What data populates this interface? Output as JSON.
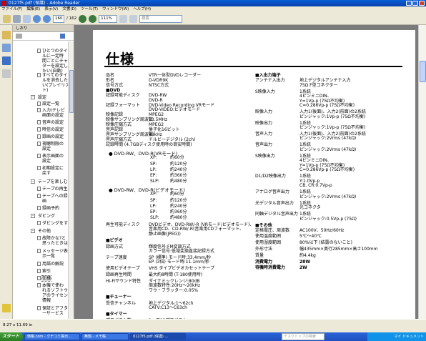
{
  "window": {
    "title": "0127f5.pdf (保護) - Adobe Reader"
  },
  "menu": [
    "ファイル(F)",
    "編集(E)",
    "表示(V)",
    "文書(D)",
    "ツール(T)",
    "ウィンドウ(W)",
    "ヘルプ(H)"
  ],
  "toolbar": {
    "page_current": "160",
    "page_total": "/ 162",
    "zoom": "111%",
    "search_placeholder": "検索"
  },
  "nav": {
    "header": "しおり",
    "items": [
      "ひとつのタイト\nルに一定時\n間ごとにチャプ\nターを設定し\nたい(自動)",
      "すべてのタイト\nルを消去した\nい(プレイリス\nト)",
      "設定",
      "設定一覧",
      "入力/テレビ\n画面の設定",
      "音声の設定",
      "時信の設定",
      "録画の設定",
      "視聴制限の\n設定",
      "表示画面の\n設定",
      "初期設定に\n戻す",
      "テープを楽しむ",
      "テープの再生",
      "テープへの録\n画",
      "録画予約",
      "ダビング",
      "ダビングをする",
      "その他",
      "故障かな?と\n思ったときは",
      "メッセージ表\n示一覧",
      "用語の解説",
      "索引",
      "仕様",
      "本機で使わ\nれるソフトウェ\nアのライセンス\n情報",
      "保証とアフタ\nーサービス"
    ]
  },
  "doc": {
    "title": "仕様",
    "left_rows": [
      {
        "label": "品名",
        "value": "VTR一体型DVDレコーダー"
      },
      {
        "label": "形名",
        "value": "D-VDR9K"
      },
      {
        "label": "信号方式",
        "value": "NTSC方式"
      },
      {
        "label": "■DVD",
        "value": ""
      },
      {
        "label": "記録可能ディスク",
        "value": "DVD-RW\nDVD-R"
      },
      {
        "label": "記録フォーマット",
        "value": "DVD-Video Recording:VRモード\nDVD-VIDEO:ビデオモード"
      },
      {
        "label": "映像記録",
        "value": "MPEG2"
      },
      {
        "label": "映像サンプリング周波数",
        "value": "13.5MHz"
      },
      {
        "label": "映像圧縮方式",
        "value": "MPEG2"
      },
      {
        "label": "音声記録",
        "value": "量子化16ビット"
      },
      {
        "label": "音声サンプリング周波数",
        "value": "48kHz"
      },
      {
        "label": "音声圧縮方式",
        "value": "ドルビーデジタル (2ch)"
      },
      {
        "label": "記録時間 (4.7GBディスク使用時の目安時間)",
        "value": ""
      }
    ],
    "vr_heading": "DVD-RW、DVD-R(VRモード)",
    "vr_modes": [
      [
        "XP:",
        "約60分"
      ],
      [
        "SP:",
        "約120分"
      ],
      [
        "LP:",
        "約240分"
      ],
      [
        "EP:",
        "約360分"
      ],
      [
        "SLP:",
        "約480分"
      ]
    ],
    "video_heading": "DVD-RW、DVD-R(ビデオモード)",
    "video_modes": [
      [
        "XP:",
        "約60分"
      ],
      [
        "SP:",
        "約120分"
      ],
      [
        "LP:",
        "約240分"
      ],
      [
        "EP:",
        "約360分"
      ],
      [
        "SLP:",
        "約480分"
      ]
    ],
    "left_rows2": [
      {
        "label": "再生可能ディスク",
        "value": "DVDビデオ、DVD-RW/-R (VRモード/ビデオモード)、\n音楽用CD、CD-RW/-R(音楽用CDフォーマット、\n静止画像(JPEG))"
      },
      {
        "label": "■ビデオ",
        "value": ""
      },
      {
        "label": "録画方式",
        "value": "輝度信号:FM変調方式\nカラー信号:低域変換直接記録方式"
      },
      {
        "label": "テープ速度",
        "value": "SP (標準) モード時:33.4mm/秒\nEP (3倍) モード時:11.1mm/秒"
      },
      {
        "label": "使用ビデオテープ",
        "value": "VHS タイプビデオカセットテープ"
      },
      {
        "label": "録画再生時間",
        "value": "最大約8時間 (T-180使用時)"
      },
      {
        "label": "Hi-Fiサウンド特性",
        "value": "ダイナミックレンジ:80dB\n周波数特性:20Hz〜20kHz\nワウ・フラッター:0.05%"
      },
      {
        "label": "■チューナー",
        "value": ""
      },
      {
        "label": "受信チャンネル",
        "value": "地上デジタル:1〜62ch\nCATV:C13〜C63ch"
      },
      {
        "label": "■タイマー",
        "value": ""
      },
      {
        "label": "プログラム数",
        "value": "1ヶ月12プログラム"
      }
    ],
    "right_rows": [
      {
        "label": "■入出力端子",
        "value": ""
      },
      {
        "label": "アンテナ入出力",
        "value": "地上デジタルアンテナ入力\n75Ω F型コネクター"
      },
      {
        "label": "S映像入力",
        "value": "1系統\n4ピンミニDIN、\nY=1Vp-p (75Ω不均衡)\nC=0.286Vp-p (75Ω不均衡)"
      },
      {
        "label": "映像入力",
        "value": "入力1(後面)、入力2(前面)の2系統\nピンジャック:1Vp-p (75Ω不均衡)"
      },
      {
        "label": "映像出力",
        "value": "1系統\nピンジャック:1Vp-p (75Ω不均衡)"
      },
      {
        "label": "音声入力",
        "value": "入力1(後面)、入力2(前面)の2系統\nピンジャック:2Vrms (47kΩ)"
      },
      {
        "label": "音声出力",
        "value": "1系統\nピンジャック:2Vrms (47kΩ)"
      },
      {
        "label": "S映像出力",
        "value": "1系統\n4ピンミニDIN、\nY=1Vp-p (75Ω不均衡)\nC=0.286Vp-p (75Ω不均衡)"
      },
      {
        "label": "D1/D2映像出力",
        "value": "1系統\nY:1.0Vp-p\nCB, CR:0.7Vp-p"
      },
      {
        "label": "アナログ音声出力",
        "value": "1系統\nピンジャック:2Vrms (47kΩ)"
      },
      {
        "label": "光デジタル音声出力",
        "value": "1系統\n光コネクタ"
      },
      {
        "label": "同軸デジタル音声出力",
        "value": "1系統\nピンジャック:0.5Vp-p (75Ω)"
      },
      {
        "label": "■その他",
        "value": ""
      },
      {
        "label": "定格電圧、周波数",
        "value": "AC100V、50Hz/60Hz"
      },
      {
        "label": "使用温度範囲",
        "value": "5℃〜40℃"
      },
      {
        "label": "使用湿度範囲",
        "value": "80%以下 (結露のないこと)"
      },
      {
        "label": "外形寸法",
        "value": "幅435mm×奥行285mm×高さ100mm"
      },
      {
        "label": "質量",
        "value": "約4.4kg"
      },
      {
        "label": "消費電力",
        "value": "28W"
      },
      {
        "label": "待機時消費電力",
        "value": "2W"
      }
    ]
  },
  "status": {
    "size": "8.27 x 11.69 in"
  },
  "taskbar": {
    "start": "スタート",
    "tasks": [
      "価格.com - クチコミ掲示...",
      "無題 - メモ帳",
      "0127f5.pdf (保護) ..."
    ],
    "search_placeholder": "デスクトップの検索",
    "tray": "マイ ドキュメント"
  }
}
